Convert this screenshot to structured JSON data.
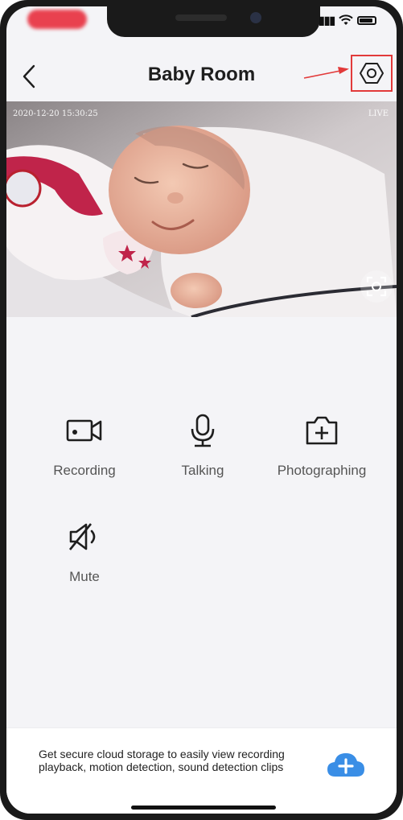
{
  "header": {
    "title": "Baby Room",
    "back_icon": "chevron-left-icon",
    "settings_icon": "hexagon-gear-icon"
  },
  "video": {
    "timestamp": "2020-12-20  15:30:25",
    "live_label": "LIVE",
    "fullscreen_icon": "fullscreen-icon"
  },
  "actions": {
    "recording": {
      "label": "Recording",
      "icon": "video-camera-icon"
    },
    "talking": {
      "label": "Talking",
      "icon": "microphone-icon"
    },
    "photographing": {
      "label": "Photographing",
      "icon": "add-photo-icon"
    },
    "mute": {
      "label": "Mute",
      "icon": "speaker-mute-icon"
    }
  },
  "promo": {
    "text": "Get secure cloud storage to easily view recording playback, motion detection, sound detection clips",
    "icon": "cloud-add-icon"
  },
  "colors": {
    "accent_blue": "#3a8ee6",
    "annotation_red": "#e23a3a",
    "background": "#f4f4f7"
  }
}
